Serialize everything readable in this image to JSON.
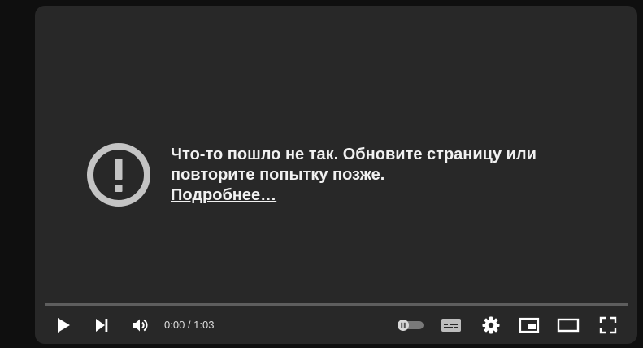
{
  "error": {
    "message_line1": "Что-то пошло не так. Обновите страницу или",
    "message_line2": "повторите попытку позже.",
    "link_text": "Подробнее…"
  },
  "time": {
    "current": "0:00",
    "separator": " / ",
    "duration": "1:03"
  },
  "playback_progress": 0,
  "controls": {
    "play": "play-icon",
    "next": "skip-next-icon",
    "volume": "volume-icon",
    "autoplay": "autoplay-toggle-icon",
    "subtitles": "subtitles-icon",
    "settings": "gear-icon",
    "miniplayer": "miniplayer-icon",
    "theater": "theater-mode-icon",
    "fullscreen": "fullscreen-icon"
  },
  "colors": {
    "background": "#0f0f0f",
    "player": "#282828",
    "icon": "#ffffff",
    "error_icon": "#c4c4c4",
    "progress_track": "#5d5d5d"
  }
}
